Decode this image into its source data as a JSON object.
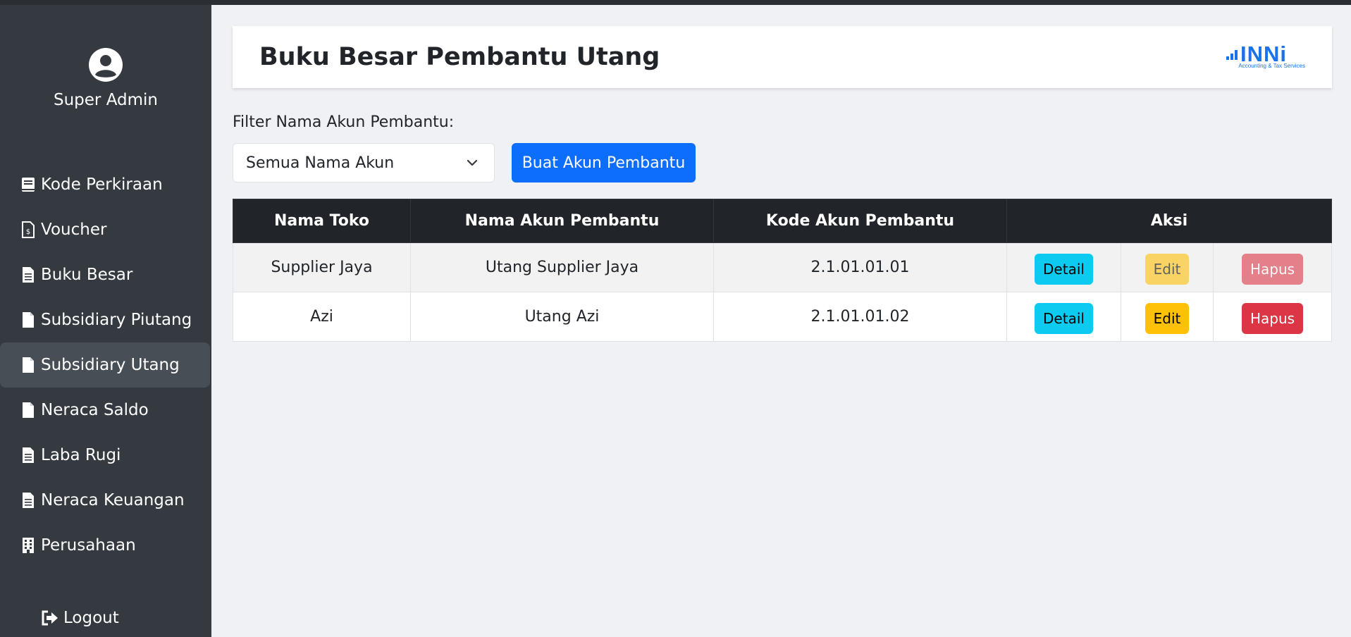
{
  "user": {
    "name": "Super Admin"
  },
  "sidebar": {
    "items": [
      {
        "label": "Kode Perkiraan",
        "icon": "book-icon"
      },
      {
        "label": "Voucher",
        "icon": "file-dollar-icon"
      },
      {
        "label": "Buku Besar",
        "icon": "file-text-icon"
      },
      {
        "label": "Subsidiary Piutang",
        "icon": "file-icon"
      },
      {
        "label": "Subsidiary Utang",
        "icon": "file-icon",
        "active": true
      },
      {
        "label": "Neraca Saldo",
        "icon": "file-icon"
      },
      {
        "label": "Laba Rugi",
        "icon": "file-text-icon"
      },
      {
        "label": "Neraca Keuangan",
        "icon": "file-text-icon"
      },
      {
        "label": "Perusahaan",
        "icon": "building-icon"
      }
    ],
    "logout_label": "Logout"
  },
  "header": {
    "title": "Buku Besar Pembantu Utang",
    "logo_text": "INNi",
    "logo_sub": "Accounting & Tax Services"
  },
  "filter": {
    "label": "Filter Nama Akun Pembantu:",
    "selected": "Semua Nama Akun",
    "create_button": "Buat Akun Pembantu"
  },
  "table": {
    "headers": [
      "Nama Toko",
      "Nama Akun Pembantu",
      "Kode Akun Pembantu",
      "Aksi"
    ],
    "rows": [
      {
        "toko": "Supplier Jaya",
        "akun": "Utang Supplier Jaya",
        "kode": "2.1.01.01.01"
      },
      {
        "toko": "Azi",
        "akun": "Utang Azi",
        "kode": "2.1.01.01.02"
      }
    ],
    "actions": {
      "detail": "Detail",
      "edit": "Edit",
      "hapus": "Hapus"
    }
  },
  "colors": {
    "sidebar_bg": "#343a40",
    "primary": "#0d6efd",
    "info": "#0dcaf0",
    "warning": "#ffc107",
    "danger": "#dc3545",
    "brand": "#1a73e8"
  }
}
